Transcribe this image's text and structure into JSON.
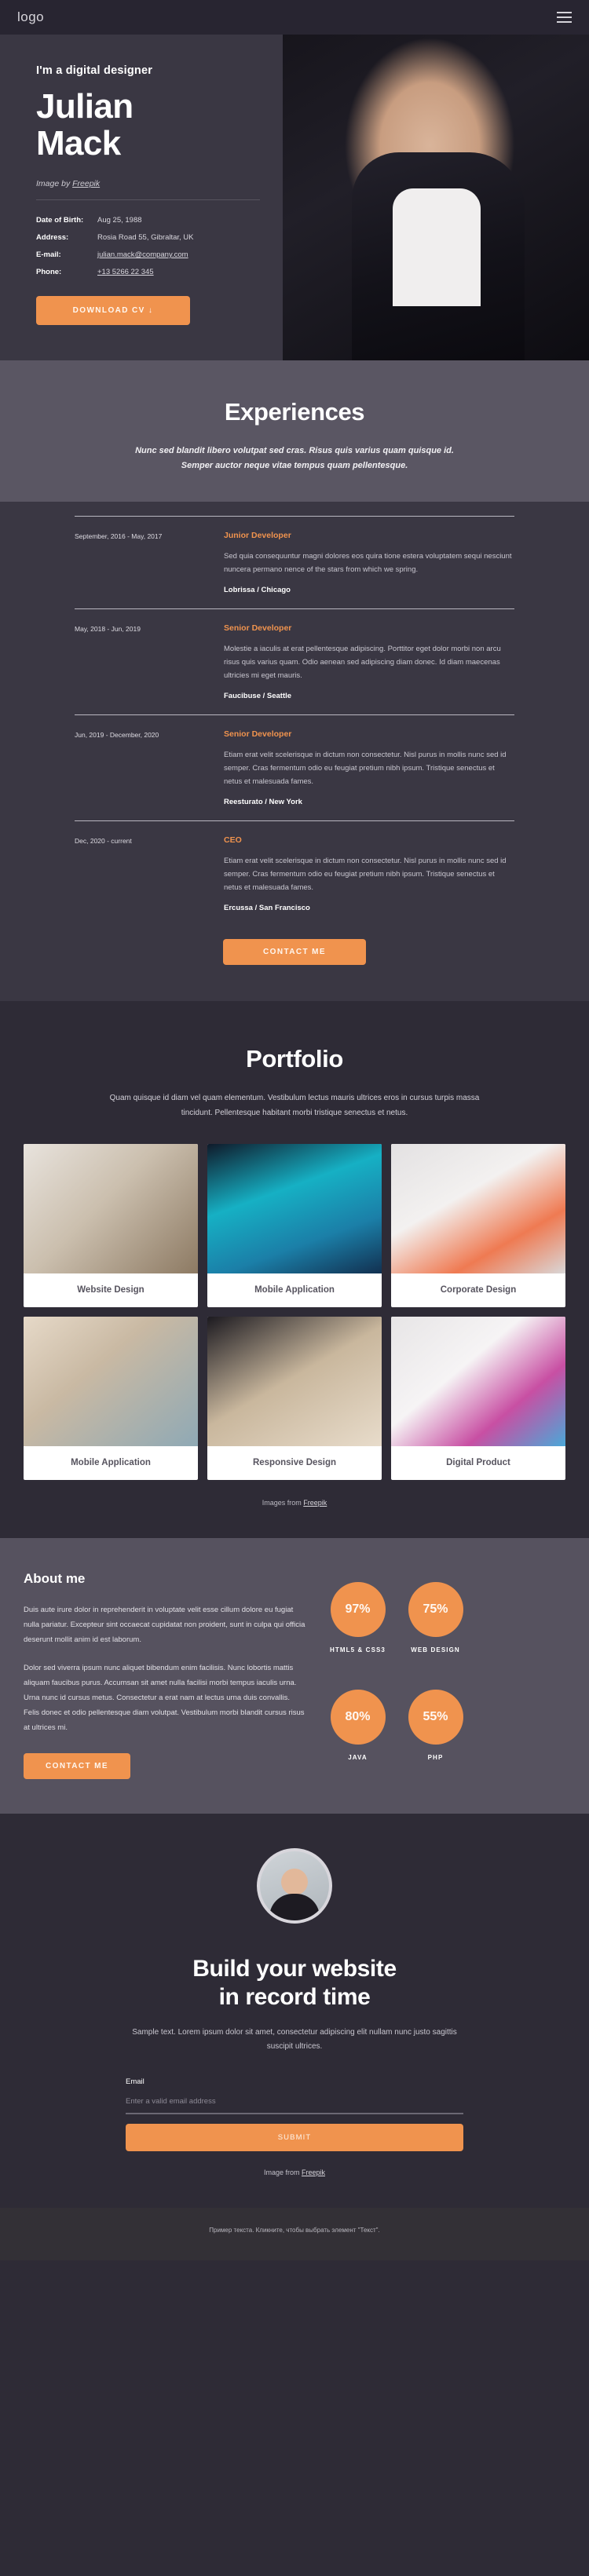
{
  "nav": {
    "logo": "logo",
    "menu_icon": "hamburger-menu-icon"
  },
  "hero": {
    "kicker": "I'm a digital designer",
    "name_line1": "Julian",
    "name_line2": "Mack",
    "credit_prefix": "Image by ",
    "credit_link": "Freepik",
    "info": [
      {
        "label": "Date of Birth:",
        "value": "Aug 25, 1988",
        "link": false
      },
      {
        "label": "Address:",
        "value": "Rosia Road 55, Gibraltar, UK",
        "link": false
      },
      {
        "label": "E-mail:",
        "value": "julian.mack@company.com",
        "link": true
      },
      {
        "label": "Phone:",
        "value": "+13 5266 22 345",
        "link": true
      }
    ],
    "cv_button": "DOWNLOAD CV  ↓"
  },
  "experiences": {
    "title": "Experiences",
    "subtitle": "Nunc sed blandit libero volutpat sed cras. Risus quis varius quam quisque id. Semper auctor neque vitae tempus quam pellentesque.",
    "items": [
      {
        "date": "September, 2016 - May, 2017",
        "role": "Junior Developer",
        "desc": "Sed quia consequuntur magni dolores eos quira tione estera voluptatem sequi nesciunt nuncera permano nence of the stars from which we spring.",
        "place": "Lobrissa / Chicago"
      },
      {
        "date": "May, 2018 - Jun, 2019",
        "role": "Senior Developer",
        "desc": "Molestie a iaculis at erat pellentesque adipiscing. Porttitor eget dolor morbi non arcu risus quis varius quam. Odio aenean sed adipiscing diam donec. Id diam maecenas ultricies mi eget mauris.",
        "place": "Faucibuse / Seattle"
      },
      {
        "date": "Jun, 2019 - December, 2020",
        "role": "Senior Developer",
        "desc": "Etiam erat velit scelerisque in dictum non consectetur. Nisl purus in mollis nunc sed id semper. Cras fermentum odio eu feugiat pretium nibh ipsum. Tristique senectus et netus et malesuada fames.",
        "place": "Reesturato / New York"
      },
      {
        "date": "Dec, 2020 - current",
        "role": "CEO",
        "desc": "Etiam erat velit scelerisque in dictum non consectetur. Nisl purus in mollis nunc sed id semper. Cras fermentum odio eu feugiat pretium nibh ipsum. Tristique senectus et netus et malesuada fames.",
        "place": "Ercussa / San Francisco"
      }
    ],
    "contact_button": "CONTACT ME"
  },
  "portfolio": {
    "title": "Portfolio",
    "description": "Quam quisque id diam vel quam elementum. Vestibulum lectus mauris ultrices eros in cursus turpis massa tincidunt. Pellentesque habitant morbi tristique senectus et netus.",
    "cards": [
      {
        "label": "Website Design"
      },
      {
        "label": "Mobile Application"
      },
      {
        "label": "Corporate Design"
      },
      {
        "label": "Mobile Application"
      },
      {
        "label": "Responsive Design"
      },
      {
        "label": "Digital Product"
      }
    ],
    "credit_prefix": "Images from ",
    "credit_link": "Freepik"
  },
  "about": {
    "title": "About me",
    "paragraph1": "Duis aute irure dolor in reprehenderit in voluptate velit esse cillum dolore eu fugiat nulla pariatur. Excepteur sint occaecat cupidatat non proident, sunt in culpa qui officia deserunt mollit anim id est laborum.",
    "paragraph2": "Dolor sed viverra ipsum nunc aliquet bibendum enim facilisis. Nunc lobortis mattis aliquam faucibus purus. Accumsan sit amet nulla facilisi morbi tempus iaculis urna. Urna nunc id cursus metus. Consectetur a erat nam at lectus urna duis convallis. Felis donec et odio pellentesque diam volutpat. Vestibulum morbi blandit cursus risus at ultrices mi.",
    "contact_button": "CONTACT ME",
    "skills": [
      {
        "percent": "97%",
        "name": "HTML5 & CSS3"
      },
      {
        "percent": "75%",
        "name": "WEB DESIGN"
      },
      {
        "percent": "80%",
        "name": "JAVA"
      },
      {
        "percent": "55%",
        "name": "PHP"
      }
    ]
  },
  "cta": {
    "title_line1": "Build your website",
    "title_line2": "in record time",
    "subtitle": "Sample text. Lorem ipsum dolor sit amet, consectetur adipiscing elit nullam nunc justo sagittis suscipit ultrices.",
    "email_label": "Email",
    "email_placeholder": "Enter a valid email address",
    "email_value": "",
    "submit_button": "SUBMIT",
    "credit_prefix": "Image from ",
    "credit_link": "Freepik"
  },
  "footer": {
    "text": "Пример текста. Кликните, чтобы выбрать элемент \"Текст\"."
  },
  "colors": {
    "accent": "#f0934e",
    "dark": "#2e2b36",
    "mid": "#3a3743",
    "light": "#5a5663"
  }
}
